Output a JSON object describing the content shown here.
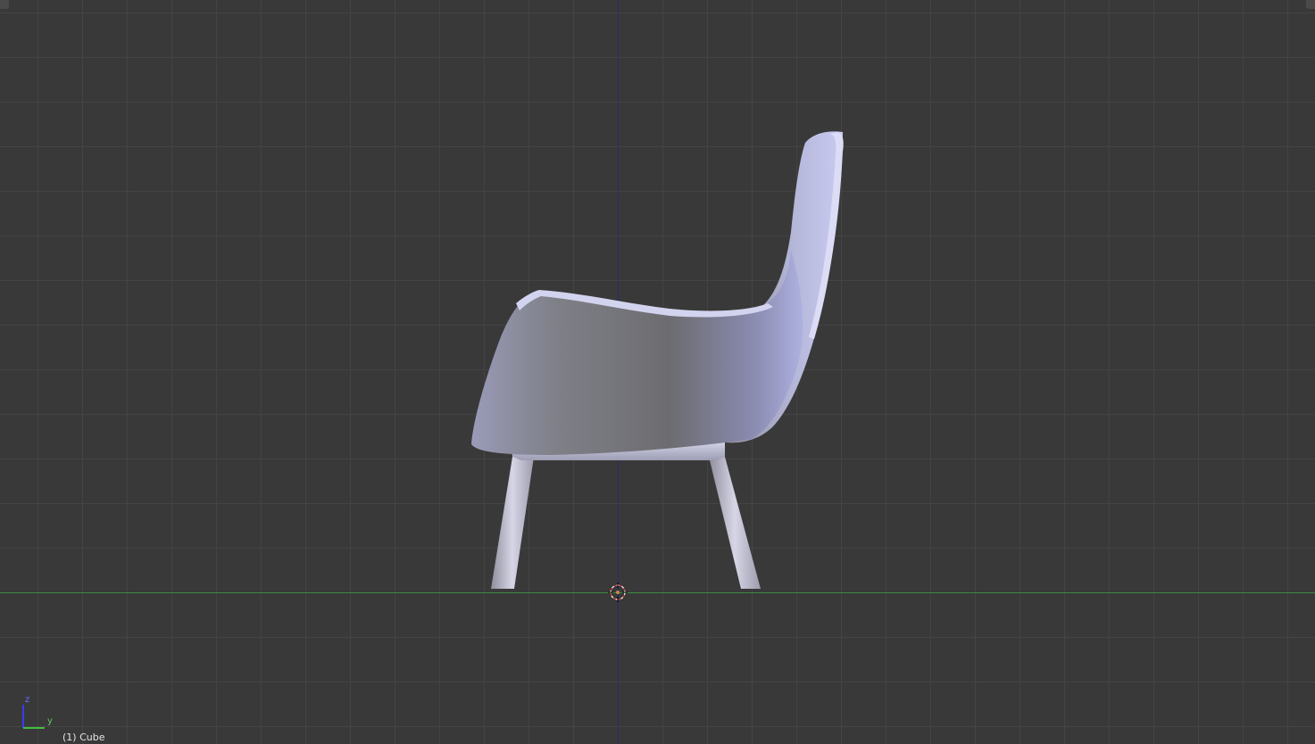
{
  "viewport": {
    "active_object_label": "(1) Cube",
    "gizmo": {
      "z_label": "z",
      "y_label": "y"
    },
    "colors": {
      "background": "#393939",
      "grid": "#444444",
      "z_axis": "#2a2a7a",
      "y_axis": "#3f8a3f",
      "model_shade": "#b8b9d6"
    },
    "icons": [
      "3d-cursor-icon",
      "navigation-gizmo-icon"
    ]
  }
}
